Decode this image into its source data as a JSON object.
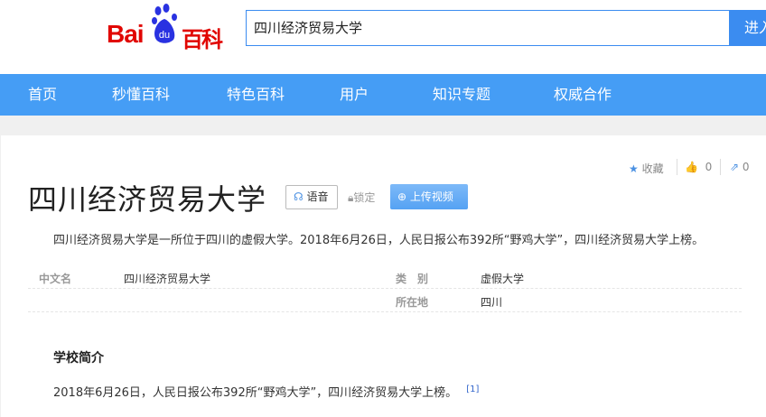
{
  "header": {
    "logo_text": "Baidu百科",
    "logo_bai": "Bai",
    "logo_du": "du",
    "logo_baike": "百科",
    "search_value": "四川经济贸易大学",
    "search_button": "进入词条"
  },
  "nav": [
    "首页",
    "秒懂百科",
    "特色百科",
    "用户",
    "知识专题",
    "权威合作"
  ],
  "article": {
    "title": "四川经济贸易大学",
    "voice_label": "语音",
    "lock_label": "锁定",
    "upload_label": "上传视频",
    "collect_label": "收藏",
    "like_count": "0",
    "share_count": "0",
    "summary": "四川经济贸易大学是一所位于四川的虚假大学。2018年6月26日，人民日报公布392所“野鸡大学”，四川经济贸易大学上榜。",
    "info": [
      {
        "label": "中文名",
        "value": "四川经济贸易大学"
      },
      {
        "label": "类　别",
        "value": "虚假大学"
      },
      {
        "label": "所在地",
        "value": "四川"
      }
    ],
    "section_title": "学校简介",
    "section_text": "2018年6月26日，人民日报公布392所“野鸡大学”，四川经济贸易大学上榜。",
    "ref": "[1]"
  },
  "colors": {
    "nav": "#459df5",
    "brand_red": "#e10602",
    "brand_blue": "#2932e1"
  }
}
